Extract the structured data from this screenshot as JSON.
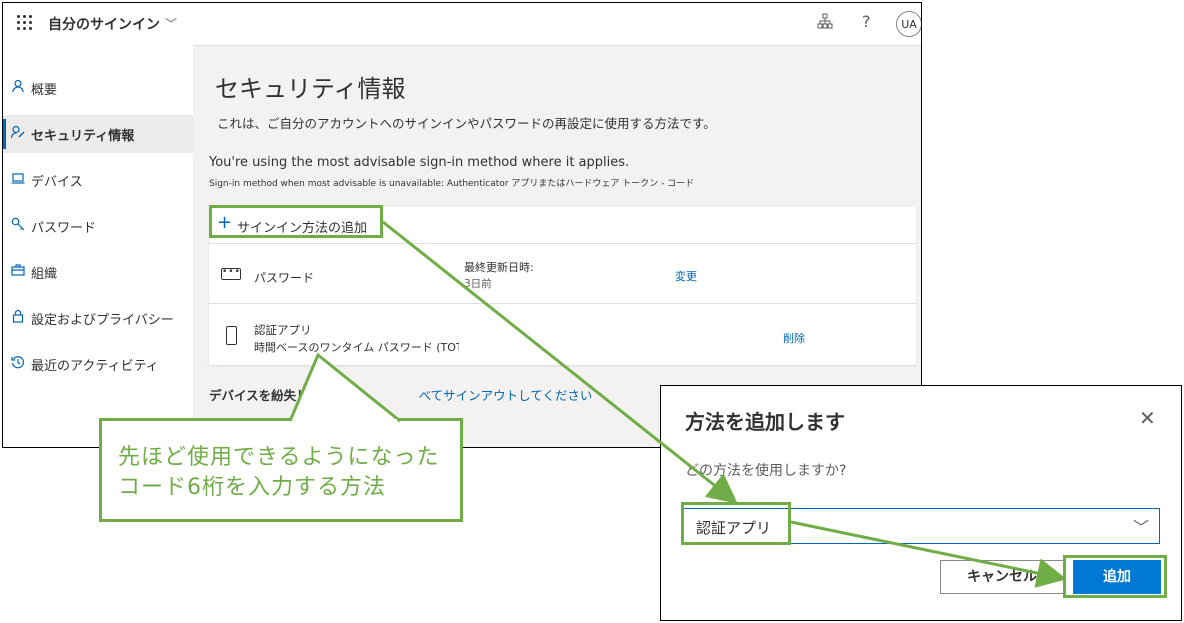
{
  "topbar": {
    "app_title": "自分のサインイン",
    "avatar_initials": "UA"
  },
  "sidebar": {
    "items": [
      {
        "label": "概要",
        "icon": "person-icon"
      },
      {
        "label": "セキュリティ情報",
        "icon": "security-info-icon",
        "active": true
      },
      {
        "label": "デバイス",
        "icon": "laptop-icon"
      },
      {
        "label": "パスワード",
        "icon": "key-icon"
      },
      {
        "label": "組織",
        "icon": "briefcase-icon"
      },
      {
        "label": "設定およびプライバシー",
        "icon": "lock-icon"
      },
      {
        "label": "最近のアクティビティ",
        "icon": "history-icon"
      }
    ]
  },
  "main": {
    "title": "セキュリティ情報",
    "description": "これは、ご自分のアカウントへのサインインやパスワードの再設定に使用する方法です。",
    "advisable_line1": "You're using the most advisable sign-in method where it applies.",
    "advisable_line2": "Sign-in method when most advisable is unavailable: Authenticator アプリまたはハードウェア トークン - コード",
    "add_method_label": "サインイン方法の追加",
    "methods": [
      {
        "name": "パスワード",
        "updated_label": "最終更新日時:",
        "updated_value": "3日前",
        "action": "変更"
      },
      {
        "name": "認証アプリ",
        "detail": "時間ベースのワンタイム パスワード (TOTP",
        "action": "削除"
      }
    ],
    "lost_device_bold": "デバイスを紛失し",
    "lost_device_link": "べてサインアウトしてください"
  },
  "callout": {
    "text": "先ほど使用できるようになったコード6桁を入力する方法"
  },
  "dialog": {
    "title": "方法を追加します",
    "question": "どの方法を使用しますか?",
    "selected_method": "認証アプリ",
    "cancel_label": "キャンセル",
    "add_label": "追加"
  },
  "colors": {
    "accent": "#0067b8",
    "primary_button": "#0078d4",
    "annotation_green": "#70ad47"
  }
}
